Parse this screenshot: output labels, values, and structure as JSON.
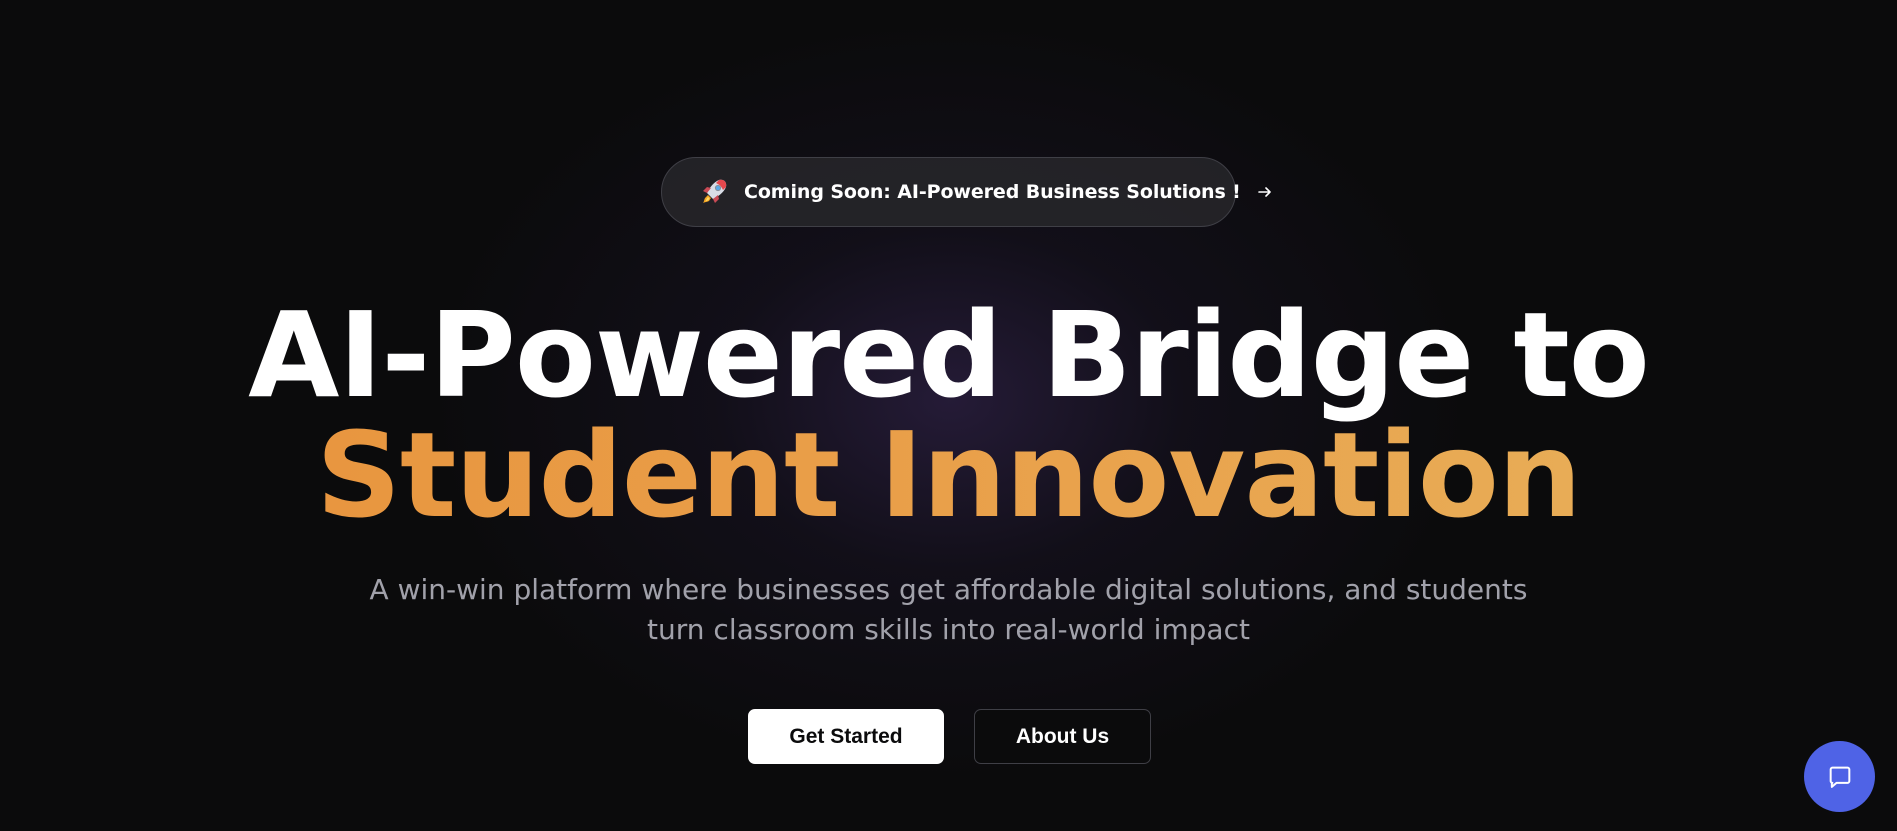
{
  "announcement": {
    "icon": "rocket-icon",
    "text": "Coming Soon: AI-Powered Business Solutions !",
    "arrow_icon": "arrow-right-icon"
  },
  "hero": {
    "title_line1": "AI-Powered Bridge to",
    "title_line2": "Student Innovation",
    "subtitle_line1": "A win-win platform where businesses get affordable digital solutions, and students",
    "subtitle_line2": "turn classroom skills into real-world impact"
  },
  "actions": {
    "primary_label": "Get Started",
    "secondary_label": "About Us"
  },
  "chat": {
    "icon": "chat-bubble-icon"
  },
  "colors": {
    "background": "#0b0b0c",
    "accent_gradient_start": "#e8913a",
    "accent_gradient_end": "#e8b25c",
    "chat_button": "#4f63e6"
  }
}
